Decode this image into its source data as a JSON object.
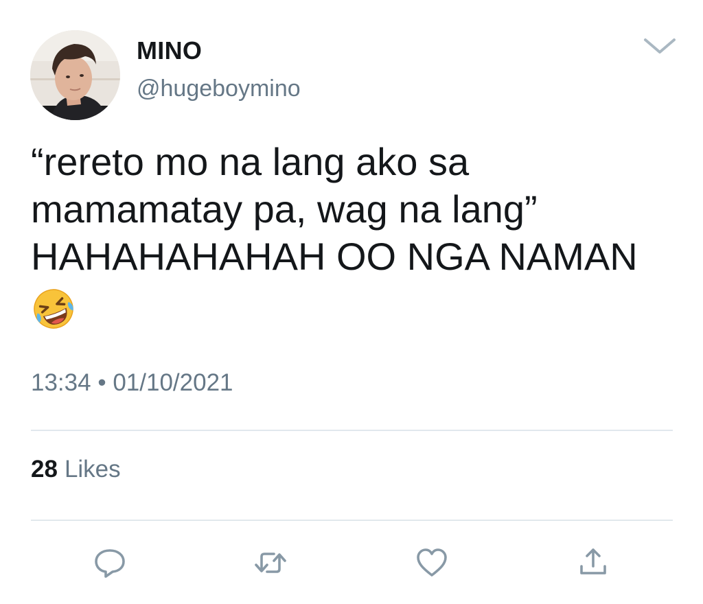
{
  "user": {
    "display_name": "MINO",
    "handle": "@hugeboymino"
  },
  "tweet": {
    "lines": [
      "“rereto mo na lang ako sa",
      "mamamatay pa, wag na lang”",
      "HAHAHAHAHAH OO NGA NAMAN"
    ],
    "emoji": "rolling-on-the-floor-laughing-emoji",
    "time": "13:34",
    "separator": "•",
    "date": "01/10/2021"
  },
  "stats": {
    "likes_count": "28",
    "likes_label": "Likes"
  },
  "actions": {
    "reply_icon": "reply-icon",
    "retweet_icon": "retweet-icon",
    "like_icon": "heart-icon",
    "share_icon": "share-icon"
  },
  "colors": {
    "text": "#14171a",
    "secondary": "#657786",
    "divider": "#e1e8ed",
    "icon": "#8899a6"
  }
}
